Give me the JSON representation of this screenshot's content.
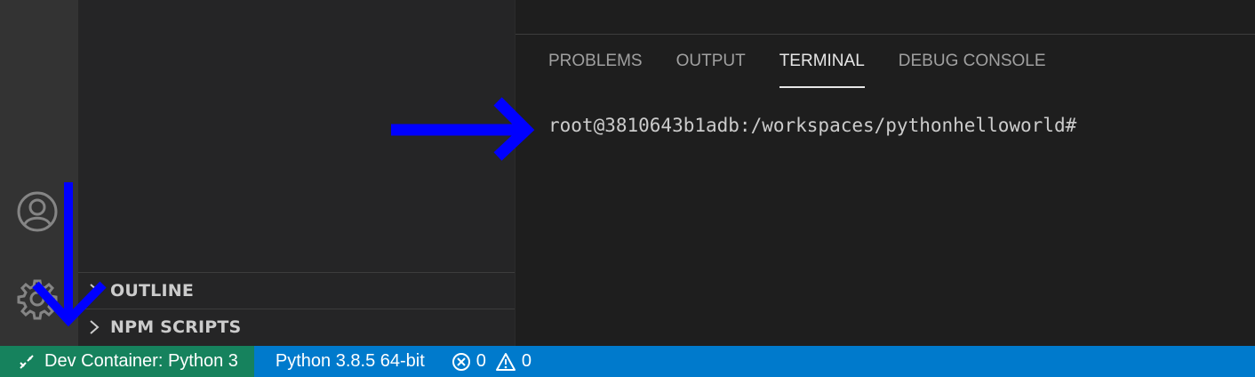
{
  "sidebar": {
    "sections": [
      {
        "label": "OUTLINE"
      },
      {
        "label": "NPM SCRIPTS"
      }
    ]
  },
  "activity_bar": {
    "icons": [
      "account-icon",
      "manage-gear-icon"
    ]
  },
  "panel": {
    "tabs": [
      {
        "label": "PROBLEMS",
        "active": false
      },
      {
        "label": "OUTPUT",
        "active": false
      },
      {
        "label": "TERMINAL",
        "active": true
      },
      {
        "label": "DEBUG CONSOLE",
        "active": false
      }
    ],
    "terminal_prompt": "root@3810643b1adb:/workspaces/pythonhelloworld#"
  },
  "statusbar": {
    "remote_label": "Dev Container: Python 3",
    "interpreter_label": "Python 3.8.5 64-bit",
    "errors": "0",
    "warnings": "0"
  },
  "colors": {
    "statusbar": "#007acc",
    "remote": "#16825d",
    "annotation_arrow": "#0000ff"
  }
}
